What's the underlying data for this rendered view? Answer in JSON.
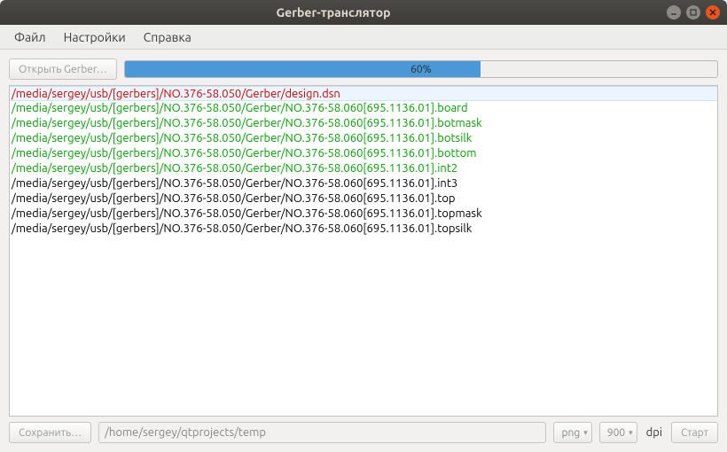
{
  "window": {
    "title": "Gerber-транслятор"
  },
  "menubar": {
    "file": "Файл",
    "settings": "Настройки",
    "help": "Справка"
  },
  "toolbar": {
    "open_label": "Открыть Gerber…"
  },
  "progress": {
    "percent": 60,
    "text": "60%"
  },
  "files": [
    {
      "path": "/media/sergey/usb/[gerbers]/NO.376-58.050/Gerber/design.dsn",
      "status": "error",
      "selected": true
    },
    {
      "path": "/media/sergey/usb/[gerbers]/NO.376-58.050/Gerber/NO.376-58.060[695.1136.01].board",
      "status": "done"
    },
    {
      "path": "/media/sergey/usb/[gerbers]/NO.376-58.050/Gerber/NO.376-58.060[695.1136.01].botmask",
      "status": "done"
    },
    {
      "path": "/media/sergey/usb/[gerbers]/NO.376-58.050/Gerber/NO.376-58.060[695.1136.01].botsilk",
      "status": "done"
    },
    {
      "path": "/media/sergey/usb/[gerbers]/NO.376-58.050/Gerber/NO.376-58.060[695.1136.01].bottom",
      "status": "done"
    },
    {
      "path": "/media/sergey/usb/[gerbers]/NO.376-58.050/Gerber/NO.376-58.060[695.1136.01].int2",
      "status": "done"
    },
    {
      "path": "/media/sergey/usb/[gerbers]/NO.376-58.050/Gerber/NO.376-58.060[695.1136.01].int3",
      "status": "pending"
    },
    {
      "path": "/media/sergey/usb/[gerbers]/NO.376-58.050/Gerber/NO.376-58.060[695.1136.01].top",
      "status": "pending"
    },
    {
      "path": "/media/sergey/usb/[gerbers]/NO.376-58.050/Gerber/NO.376-58.060[695.1136.01].topmask",
      "status": "pending"
    },
    {
      "path": "/media/sergey/usb/[gerbers]/NO.376-58.050/Gerber/NO.376-58.060[695.1136.01].topsilk",
      "status": "pending"
    }
  ],
  "bottom": {
    "save_label": "Сохранить…",
    "output_path": "/home/sergey/qtprojects/temp",
    "format_selected": "png",
    "dpi_selected": "900",
    "dpi_label": "dpi",
    "start_label": "Старт"
  },
  "colors": {
    "error": "#cc0000",
    "done": "#00a000",
    "pending": "#000000",
    "progress": "#4a98d8"
  }
}
